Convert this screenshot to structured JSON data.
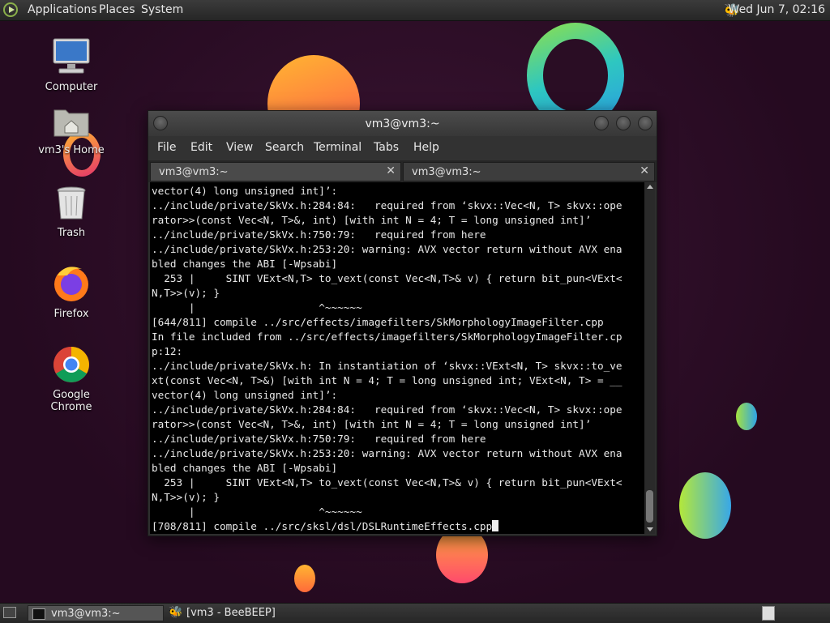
{
  "top_panel": {
    "menus": [
      "Applications",
      "Places",
      "System"
    ],
    "clock": "Wed Jun  7, 02:16"
  },
  "desktop": {
    "icons": [
      {
        "label": "Computer",
        "icon": "computer-icon"
      },
      {
        "label": "vm3's Home",
        "icon": "home-folder-icon"
      },
      {
        "label": "Trash",
        "icon": "trash-icon"
      },
      {
        "label": "Firefox",
        "icon": "firefox-icon"
      },
      {
        "label": "Google Chrome",
        "icon": "chrome-icon"
      }
    ]
  },
  "terminal": {
    "title": "vm3@vm3:~",
    "menu": [
      "File",
      "Edit",
      "View",
      "Search",
      "Terminal",
      "Tabs",
      "Help"
    ],
    "tabs": [
      {
        "label": "vm3@vm3:~",
        "close": "✕"
      },
      {
        "label": "vm3@vm3:~",
        "close": "✕"
      }
    ],
    "output": "vector(4) long unsigned int]’:\n../include/private/SkVx.h:284:84:   required from ‘skvx::Vec<N, T> skvx::ope\nrator>>(const Vec<N, T>&, int) [with int N = 4; T = long unsigned int]’\n../include/private/SkVx.h:750:79:   required from here\n../include/private/SkVx.h:253:20: warning: AVX vector return without AVX ena\nbled changes the ABI [-Wpsabi]\n  253 |     SINT VExt<N,T> to_vext(const Vec<N,T>& v) { return bit_pun<VExt<\nN,T>>(v); }\n      |                    ^~~~~~~\n[644/811] compile ../src/effects/imagefilters/SkMorphologyImageFilter.cpp\nIn file included from ../src/effects/imagefilters/SkMorphologyImageFilter.cp\np:12:\n../include/private/SkVx.h: In instantiation of ‘skvx::VExt<N, T> skvx::to_ve\nxt(const Vec<N, T>&) [with int N = 4; T = long unsigned int; VExt<N, T> = __\nvector(4) long unsigned int]’:\n../include/private/SkVx.h:284:84:   required from ‘skvx::Vec<N, T> skvx::ope\nrator>>(const Vec<N, T>&, int) [with int N = 4; T = long unsigned int]’\n../include/private/SkVx.h:750:79:   required from here\n../include/private/SkVx.h:253:20: warning: AVX vector return without AVX ena\nbled changes the ABI [-Wpsabi]\n  253 |     SINT VExt<N,T> to_vext(const Vec<N,T>& v) { return bit_pun<VExt<\nN,T>>(v); }\n      |                    ^~~~~~~\n[708/811] compile ../src/sksl/dsl/DSLRuntimeEffects.cpp"
  },
  "taskbar": {
    "tasks": [
      {
        "label": "vm3@vm3:~",
        "icon": "terminal-icon"
      },
      {
        "label": "[vm3 - BeeBEEP]",
        "icon": "beebeep-icon"
      }
    ]
  }
}
